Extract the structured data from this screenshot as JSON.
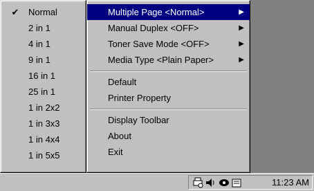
{
  "submenu": {
    "items": [
      {
        "label": "Normal",
        "checked": true
      },
      {
        "label": "2 in 1"
      },
      {
        "label": "4 in 1"
      },
      {
        "label": "9 in 1"
      },
      {
        "label": "16 in 1"
      },
      {
        "label": "25 in 1"
      },
      {
        "label": "1 in 2x2"
      },
      {
        "label": "1 in 3x3"
      },
      {
        "label": "1 in 4x4"
      },
      {
        "label": "1 in 5x5"
      }
    ],
    "check_glyph": "✔"
  },
  "menu": {
    "items": [
      {
        "label": "Multiple Page <Normal>"
      },
      {
        "label": "Manual Duplex <OFF>"
      },
      {
        "label": "Toner Save Mode <OFF>"
      },
      {
        "label": "Media Type <Plain Paper>"
      },
      {
        "label": "Default"
      },
      {
        "label": "Printer Property"
      },
      {
        "label": "Display Toolbar"
      },
      {
        "label": "About"
      },
      {
        "label": "Exit"
      }
    ],
    "arrow_glyph": "▶"
  },
  "tray": {
    "icons": [
      "printer-status-icon",
      "speaker-icon",
      "network-icon",
      "tray-app-icon"
    ],
    "clock": "11:23 AM"
  },
  "colors": {
    "menu_bg": "#c0c0c0",
    "highlight": "#000080",
    "desktop": "#808080"
  }
}
